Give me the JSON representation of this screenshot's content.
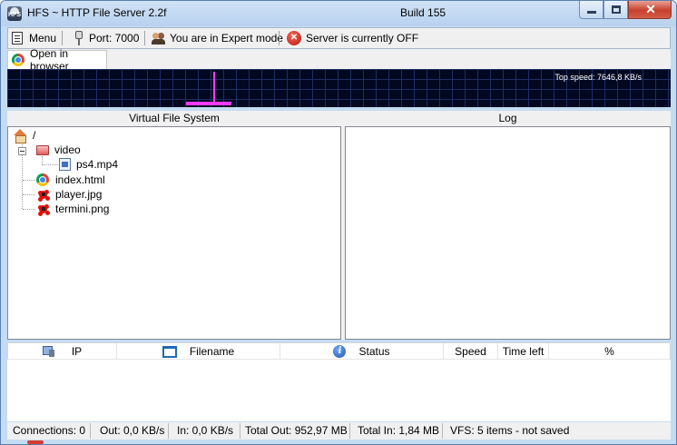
{
  "titlebar": {
    "title": "HFS ~ HTTP File Server 2.2f",
    "build": "Build 155",
    "app_icon_text": "HFS"
  },
  "toolbar": {
    "menu_label": "Menu",
    "port_label": "Port: 7000",
    "mode_label": "You are in Expert mode",
    "server_status_label": "Server is currently OFF"
  },
  "tabs": {
    "open_in_browser": "Open in browser"
  },
  "graph": {
    "top_speed": "Top speed: 7646,8 KB/s"
  },
  "panels": {
    "vfs_title": "Virtual File System",
    "log_title": "Log"
  },
  "vfs": {
    "root": "/",
    "folder": "video",
    "folder_child": "ps4.mp4",
    "files": [
      "index.html",
      "player.jpg",
      "termini.png"
    ]
  },
  "transfers": {
    "columns": [
      "IP",
      "Filename",
      "Status",
      "Speed",
      "Time left",
      "%"
    ]
  },
  "statusbar": {
    "connections": "Connections: 0",
    "out": "Out: 0,0 KB/s",
    "in": "In: 0,0 KB/s",
    "total_out": "Total Out: 952,97 MB",
    "total_in": "Total In: 1,84 MB",
    "vfs": "VFS: 5 items - not saved"
  },
  "colors": {
    "graph_bg": "#020820",
    "graph_line": "#ff39ff",
    "server_off": "#c8140c"
  }
}
